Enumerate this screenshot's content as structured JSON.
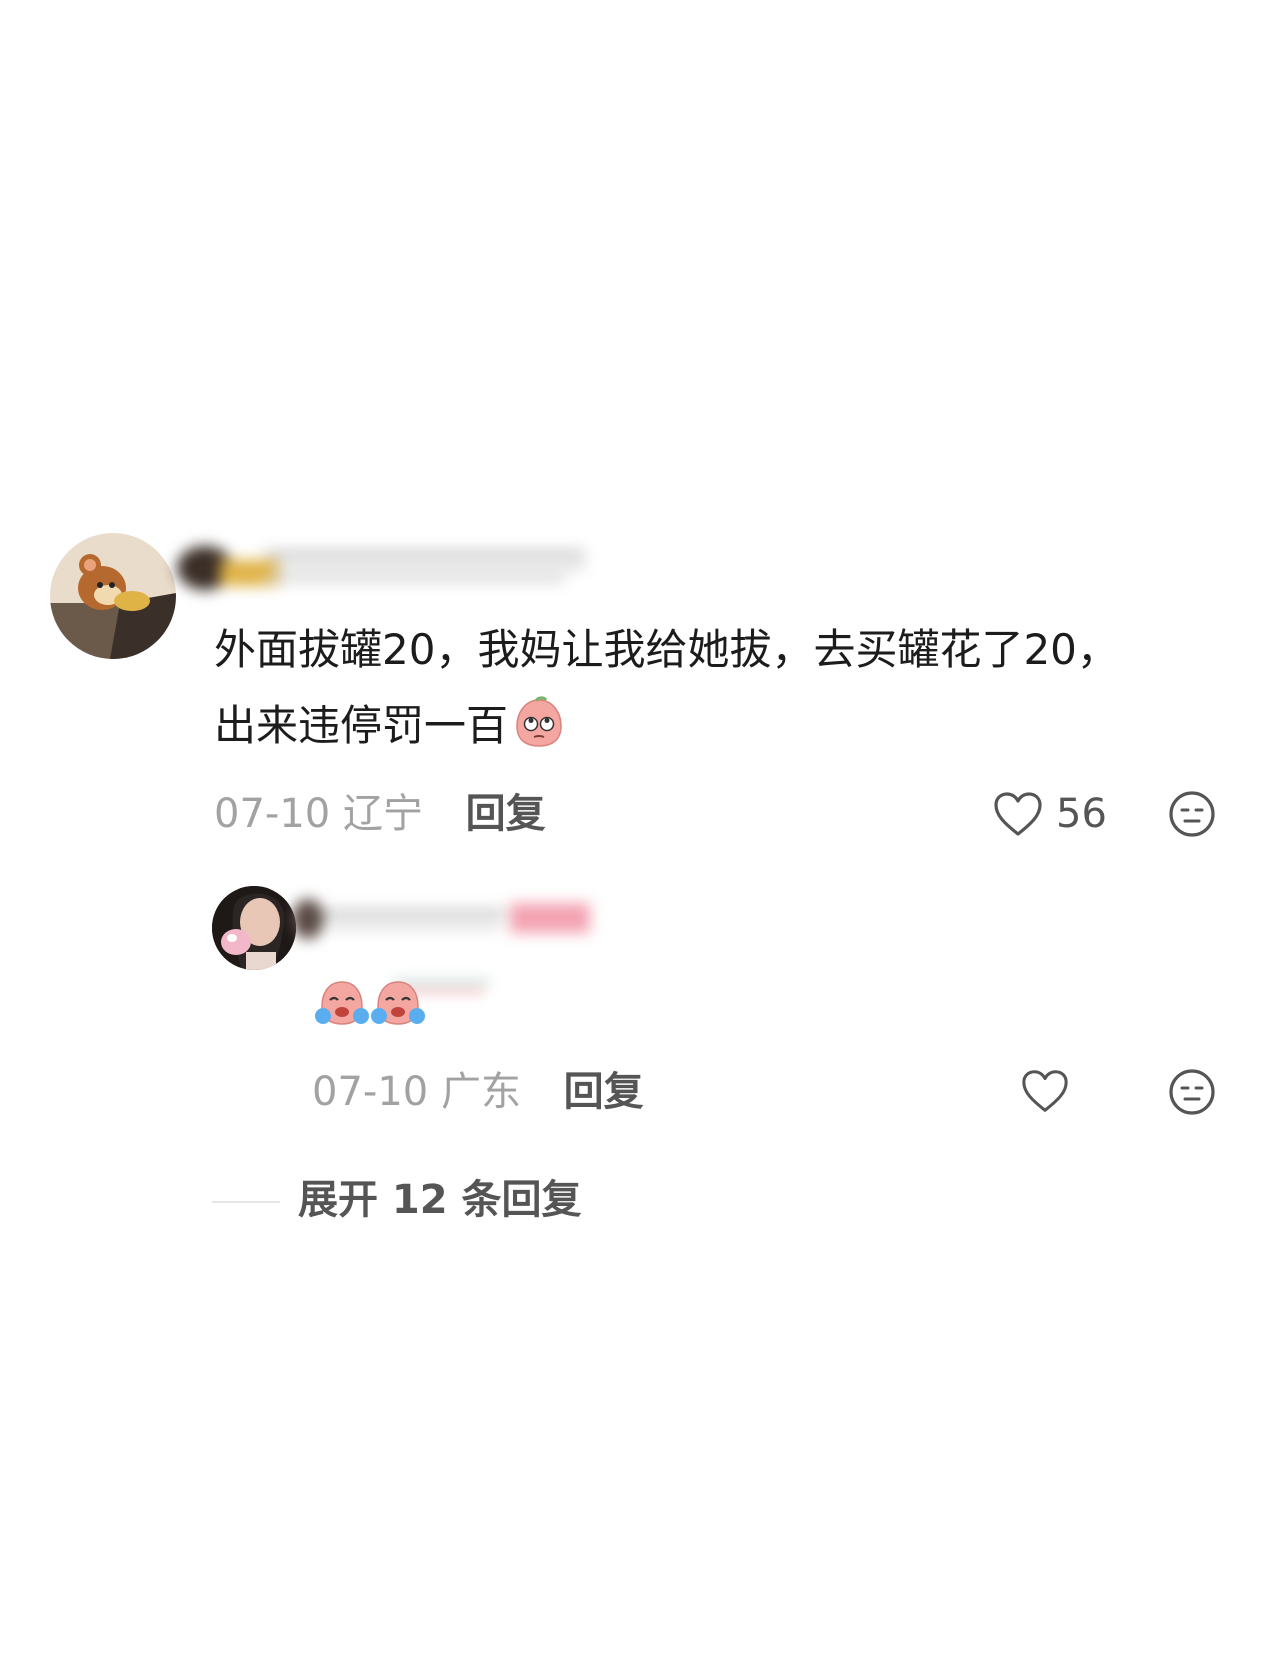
{
  "main_comment": {
    "avatar": "cartoon-mouse-avatar",
    "text_line1": "外面拔罐20，我妈让我给她拔，去买罐花了20，",
    "text_line2": "出来违停罚一百",
    "inline_emoji": "peach-rolling-eyes-emoji",
    "date": "07-10",
    "location": "辽宁",
    "reply_label": "回复",
    "like_count": "56",
    "like_icon": "heart-outline-icon",
    "dislike_icon": "neutral-face-icon"
  },
  "sub_reply": {
    "avatar": "girl-photo-avatar",
    "emojis": [
      "crying-peach-emoji",
      "crying-peach-emoji"
    ],
    "date": "07-10",
    "location": "广东",
    "reply_label": "回复",
    "like_icon": "heart-outline-icon",
    "dislike_icon": "neutral-face-icon"
  },
  "expand": {
    "label": "展开 12 条回复"
  },
  "colors": {
    "text_primary": "#1c1c1c",
    "text_meta": "#a2a2a2",
    "text_action": "#555555",
    "emoji_peach": "#f4a6a0"
  }
}
